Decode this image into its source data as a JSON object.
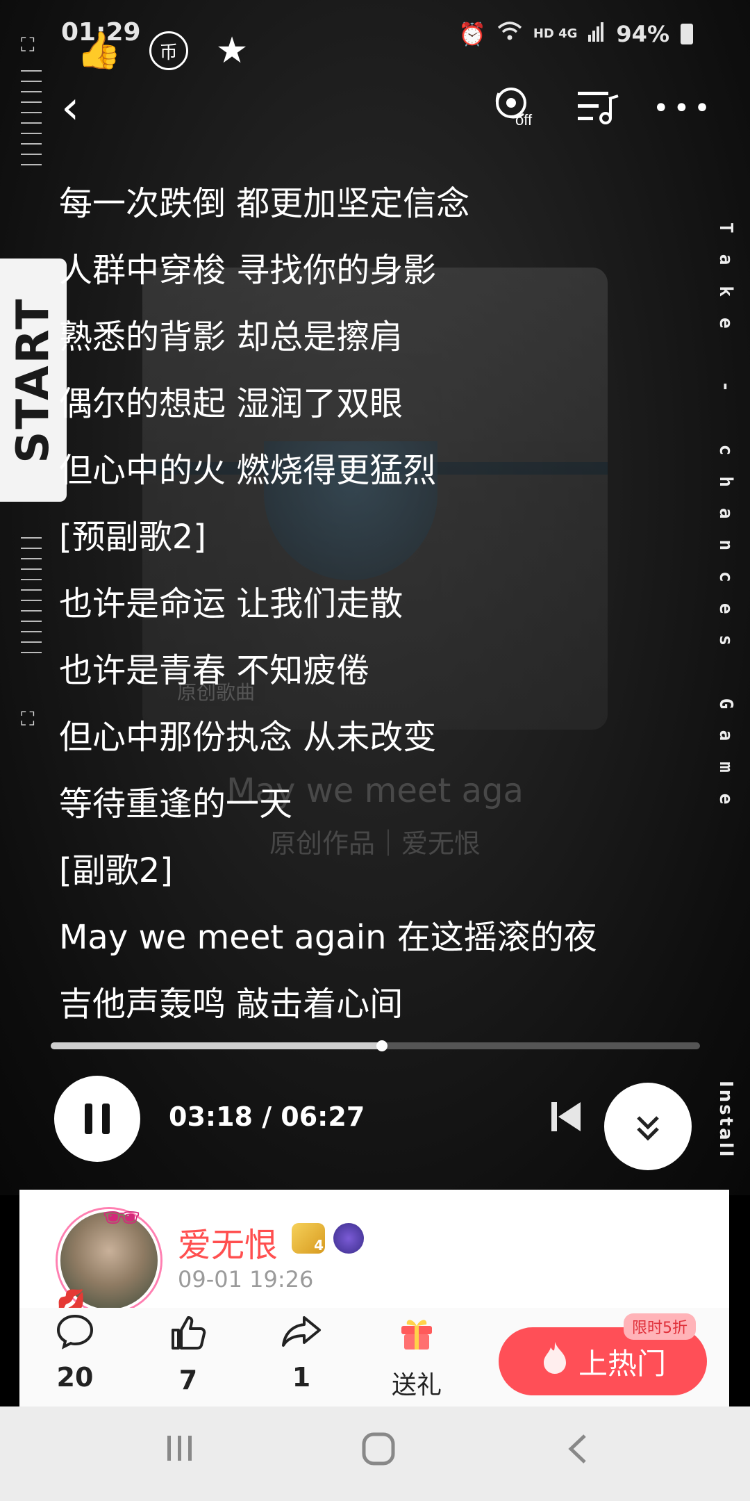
{
  "status_bar": {
    "time": "01:29",
    "network": "HD 4G",
    "battery": "94%",
    "icons": [
      "alarm-icon",
      "wifi-icon",
      "signal-icon",
      "battery-icon"
    ]
  },
  "floating_icons": [
    "thumbs-up-icon",
    "currency-icon",
    "star-icon"
  ],
  "floating_currency_glyph": "币",
  "topbar": {
    "icons": [
      "back-icon",
      "vinyl-off-icon",
      "playlist-icon",
      "more-icon"
    ],
    "vinyl_off_label": "off"
  },
  "left_rail": {
    "start_label": "START"
  },
  "right_rail": {
    "vertical_text": "Take - chances Game",
    "install_text": "Install"
  },
  "cover_ghost": {
    "tag": "原创歌曲",
    "title": "May we meet aga",
    "subtitle": "原创作品｜爱无恨"
  },
  "lyrics": [
    "每一次跌倒 都更加坚定信念",
    "人群中穿梭 寻找你的身影",
    "熟悉的背影 却总是擦肩",
    "偶尔的想起 湿润了双眼",
    "但心中的火 燃烧得更猛烈",
    "[预副歌2]",
    "也许是命运 让我们走散",
    "也许是青春 不知疲倦",
    "但心中那份执念 从未改变",
    "等待重逢的一天",
    "[副歌2]",
    "May we meet again 在这摇滚的夜",
    "吉他声轰鸣 敲击着心间"
  ],
  "player": {
    "elapsed": "03:18",
    "total": "06:27",
    "time_display": "03:18 / 06:27",
    "progress_fraction": 0.51
  },
  "post": {
    "username": "爱无恨",
    "level_badge": "4",
    "timestamp": "09-01 19:26"
  },
  "actions": {
    "comments": "20",
    "likes": "7",
    "shares": "1",
    "gift_label": "送礼",
    "hot_label": "上热门",
    "hot_tag": "限时5折"
  },
  "colors": {
    "accent_red": "#ff4f57",
    "username": "#ff4f4f"
  }
}
